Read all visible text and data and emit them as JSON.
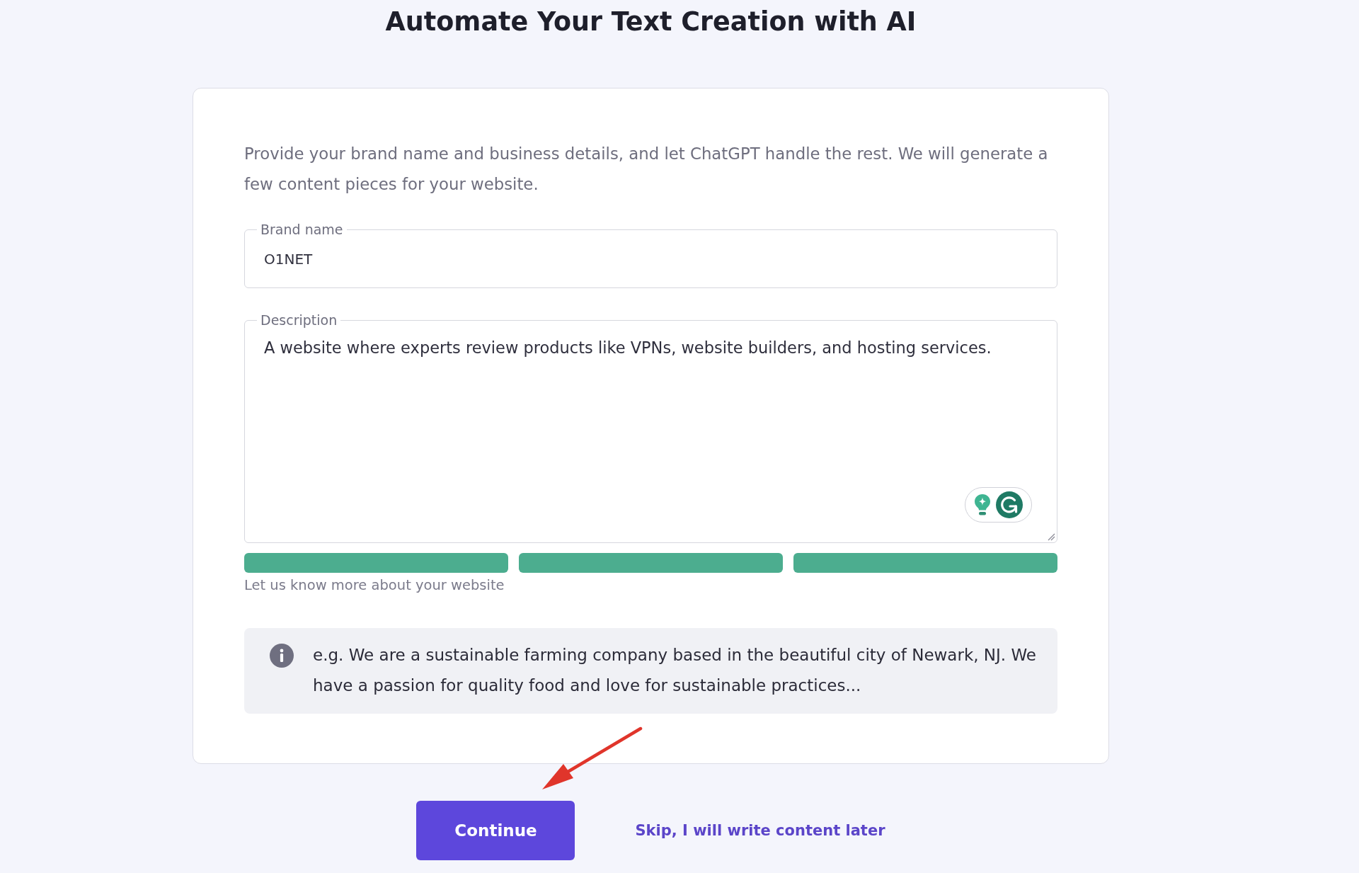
{
  "title": "Automate Your Text Creation with AI",
  "card": {
    "intro": "Provide your brand name and business details, and let ChatGPT handle the rest. We will generate a few content pieces for your website.",
    "fields": [
      {
        "kind": "input",
        "label": "Brand name",
        "value": "O1NET"
      },
      {
        "kind": "textarea",
        "label": "Description",
        "value": "A website where experts review products like VPNs, website builders, and hosting services."
      }
    ],
    "strength_meter": {
      "segments": [
        {
          "filled": true
        },
        {
          "filled": true
        },
        {
          "filled": true
        }
      ]
    },
    "hint": "Let us know more about your website",
    "example": "e.g. We are a sustainable farming company based in the beautiful city of Newark, NJ. We have a passion for quality food and love for sustainable practices..."
  },
  "actions": [
    {
      "kind": "button",
      "label": "Continue"
    },
    {
      "kind": "link",
      "label": "Skip, I will write content later"
    }
  ]
}
